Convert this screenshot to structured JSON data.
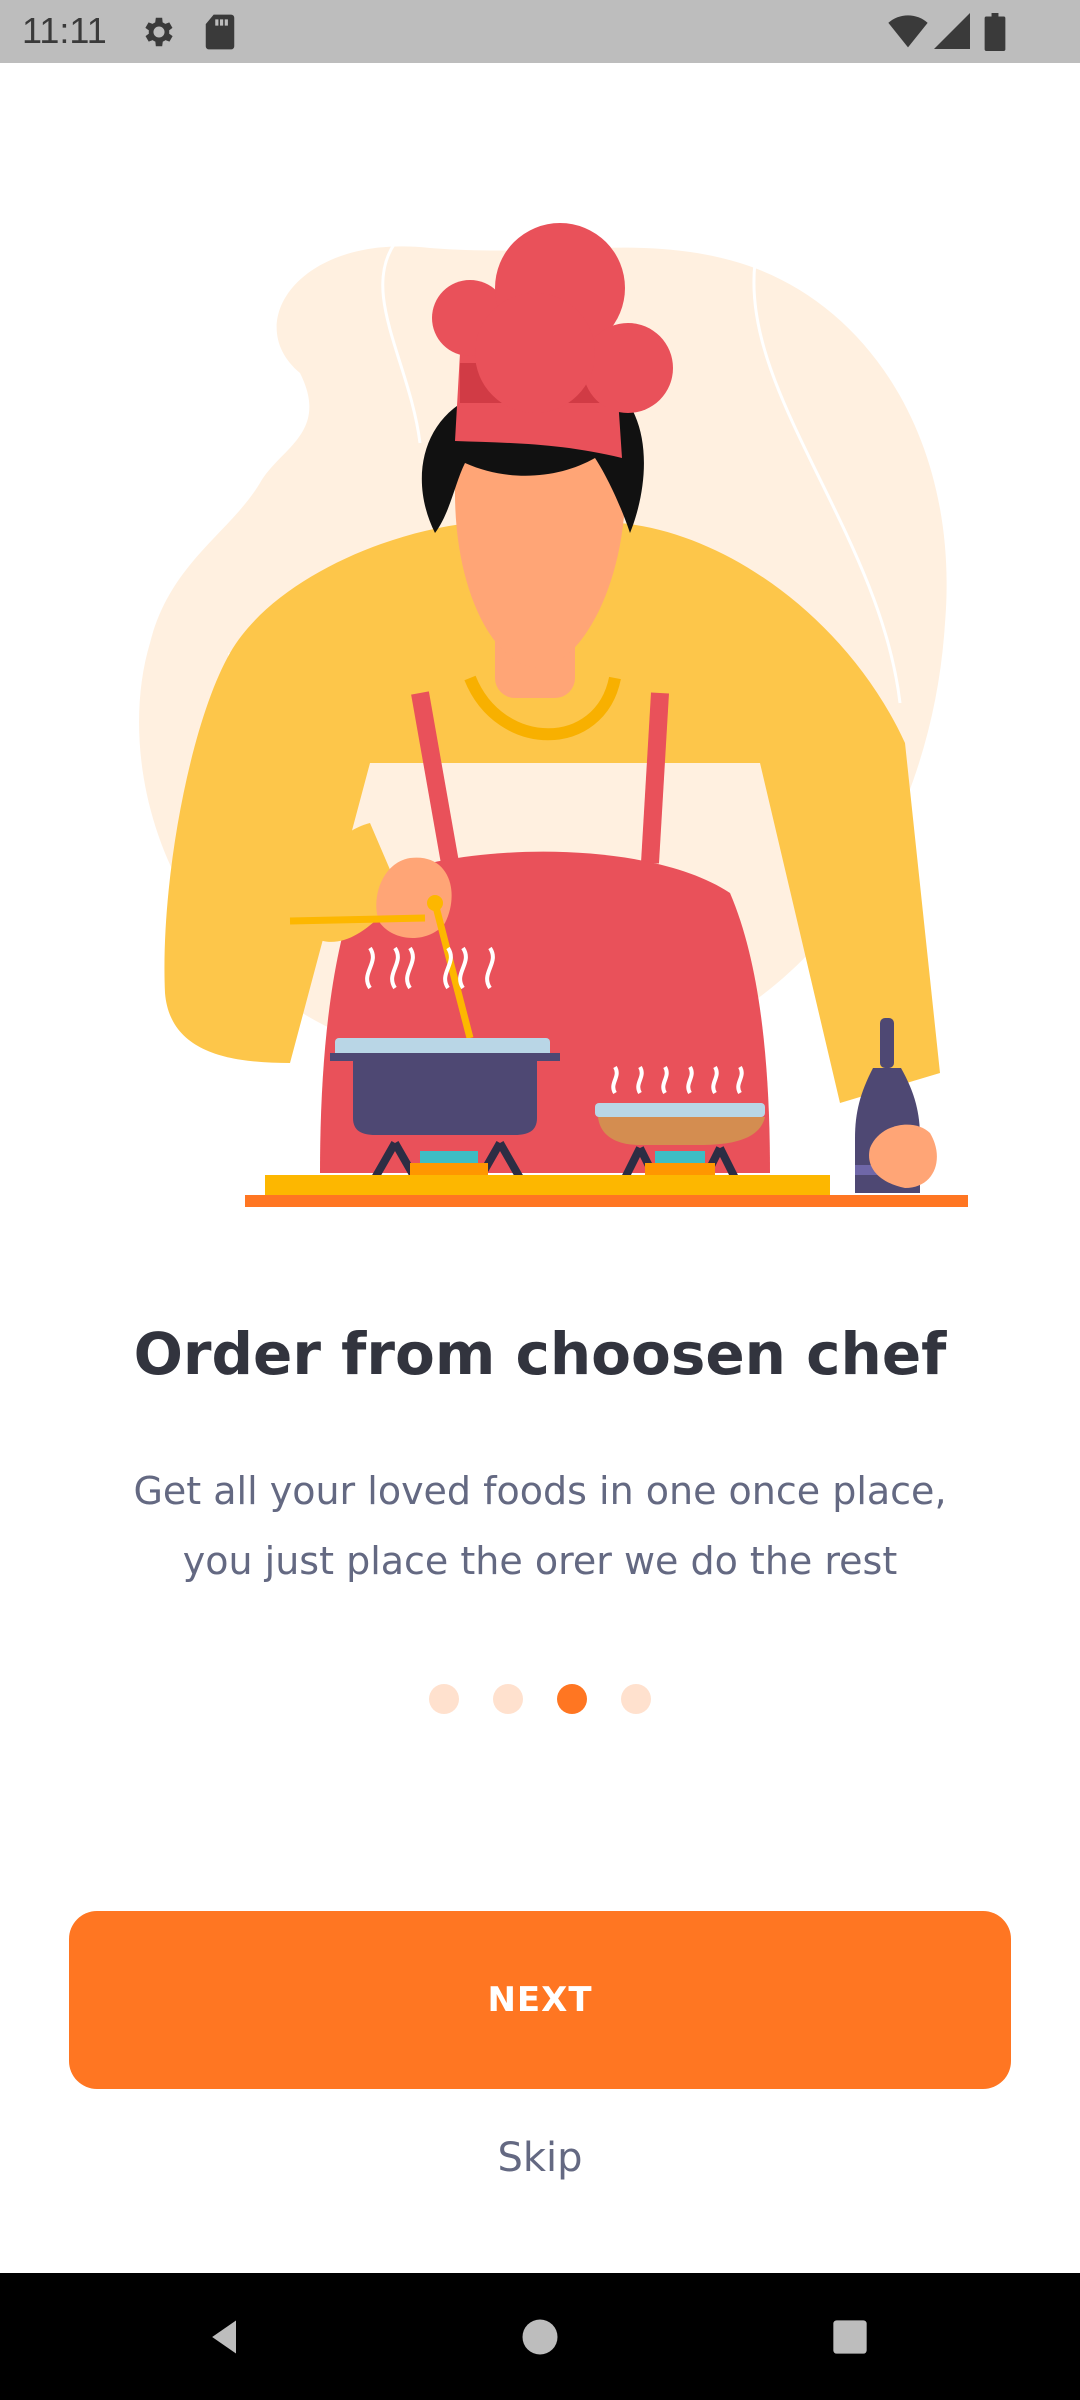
{
  "status_bar": {
    "time": "11:11",
    "icons": [
      "settings-icon",
      "sd-card-icon",
      "wifi-icon",
      "cellular-signal-icon",
      "battery-icon"
    ]
  },
  "onboarding": {
    "illustration": "chef-cooking-illustration",
    "title": "Order from choosen chef",
    "subtitle_line1": "Get all your loved foods in one once place,",
    "subtitle_line2": "you just place the orer we do the rest",
    "page_count": 4,
    "active_page": 3
  },
  "actions": {
    "next_label": "NEXT",
    "skip_label": "Skip"
  },
  "colors": {
    "accent": "#ff7622",
    "dot_inactive": "#ffe1ce",
    "title": "#32343e",
    "body_text": "#646982"
  },
  "nav_bar": {
    "icons": [
      "back-icon",
      "home-icon",
      "recents-icon"
    ]
  }
}
